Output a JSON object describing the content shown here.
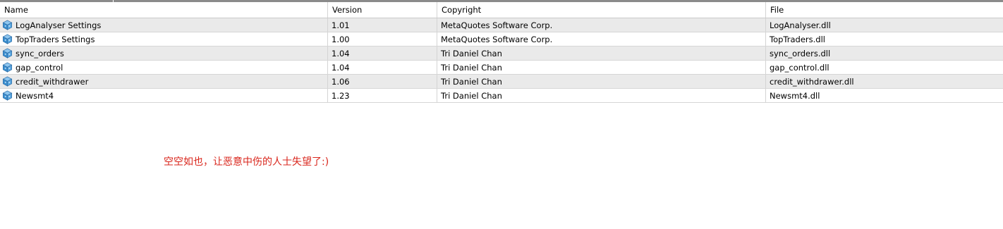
{
  "columns": {
    "name": "Name",
    "version": "Version",
    "copyright": "Copyright",
    "file": "File"
  },
  "rows": [
    {
      "name": "LogAnalyser Settings",
      "version": "1.01",
      "copyright": "MetaQuotes Software Corp.",
      "file": "LogAnalyser.dll"
    },
    {
      "name": "TopTraders Settings",
      "version": "1.00",
      "copyright": "MetaQuotes Software Corp.",
      "file": "TopTraders.dll"
    },
    {
      "name": "sync_orders",
      "version": "1.04",
      "copyright": "Tri Daniel Chan",
      "file": "sync_orders.dll"
    },
    {
      "name": "gap_control",
      "version": "1.04",
      "copyright": "Tri Daniel Chan",
      "file": "gap_control.dll"
    },
    {
      "name": "credit_withdrawer",
      "version": "1.06",
      "copyright": "Tri Daniel Chan",
      "file": "credit_withdrawer.dll"
    },
    {
      "name": "Newsmt4",
      "version": "1.23",
      "copyright": "Tri Daniel Chan",
      "file": "Newsmt4.dll"
    }
  ],
  "row_icon": "plugin-cube-icon",
  "note": "空空如也，让恶意中伤的人士失望了:)",
  "colors": {
    "row_alt": "#eaeaea",
    "note": "#d9261c",
    "icon_blue": "#3a8fd0"
  }
}
